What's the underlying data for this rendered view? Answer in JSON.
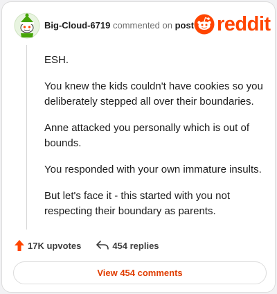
{
  "comment": {
    "username": "Big-Cloud-6719",
    "action_text": "commented on",
    "post_link": "post",
    "brand": "reddit",
    "paragraphs": [
      "ESH.",
      "You knew the kids couldn't have cookies so you deliberately stepped all over their boundaries.",
      "Anne attacked you personally which is out of bounds.",
      "You responded with your own immature insults.",
      "But let's face it - this started with you not respecting their boundary as parents."
    ]
  },
  "stats": {
    "upvotes": "17K upvotes",
    "replies": "454 replies"
  },
  "view_button": "View 454 comments",
  "colors": {
    "brand": "#ff4500",
    "link": "#e03d00",
    "avatar_green": "#46a508"
  },
  "icons": {
    "avatar": "snoo-avatar-icon",
    "logo": "reddit-logo-icon",
    "upvote": "upvote-arrow-icon",
    "reply": "reply-arrow-icon"
  }
}
